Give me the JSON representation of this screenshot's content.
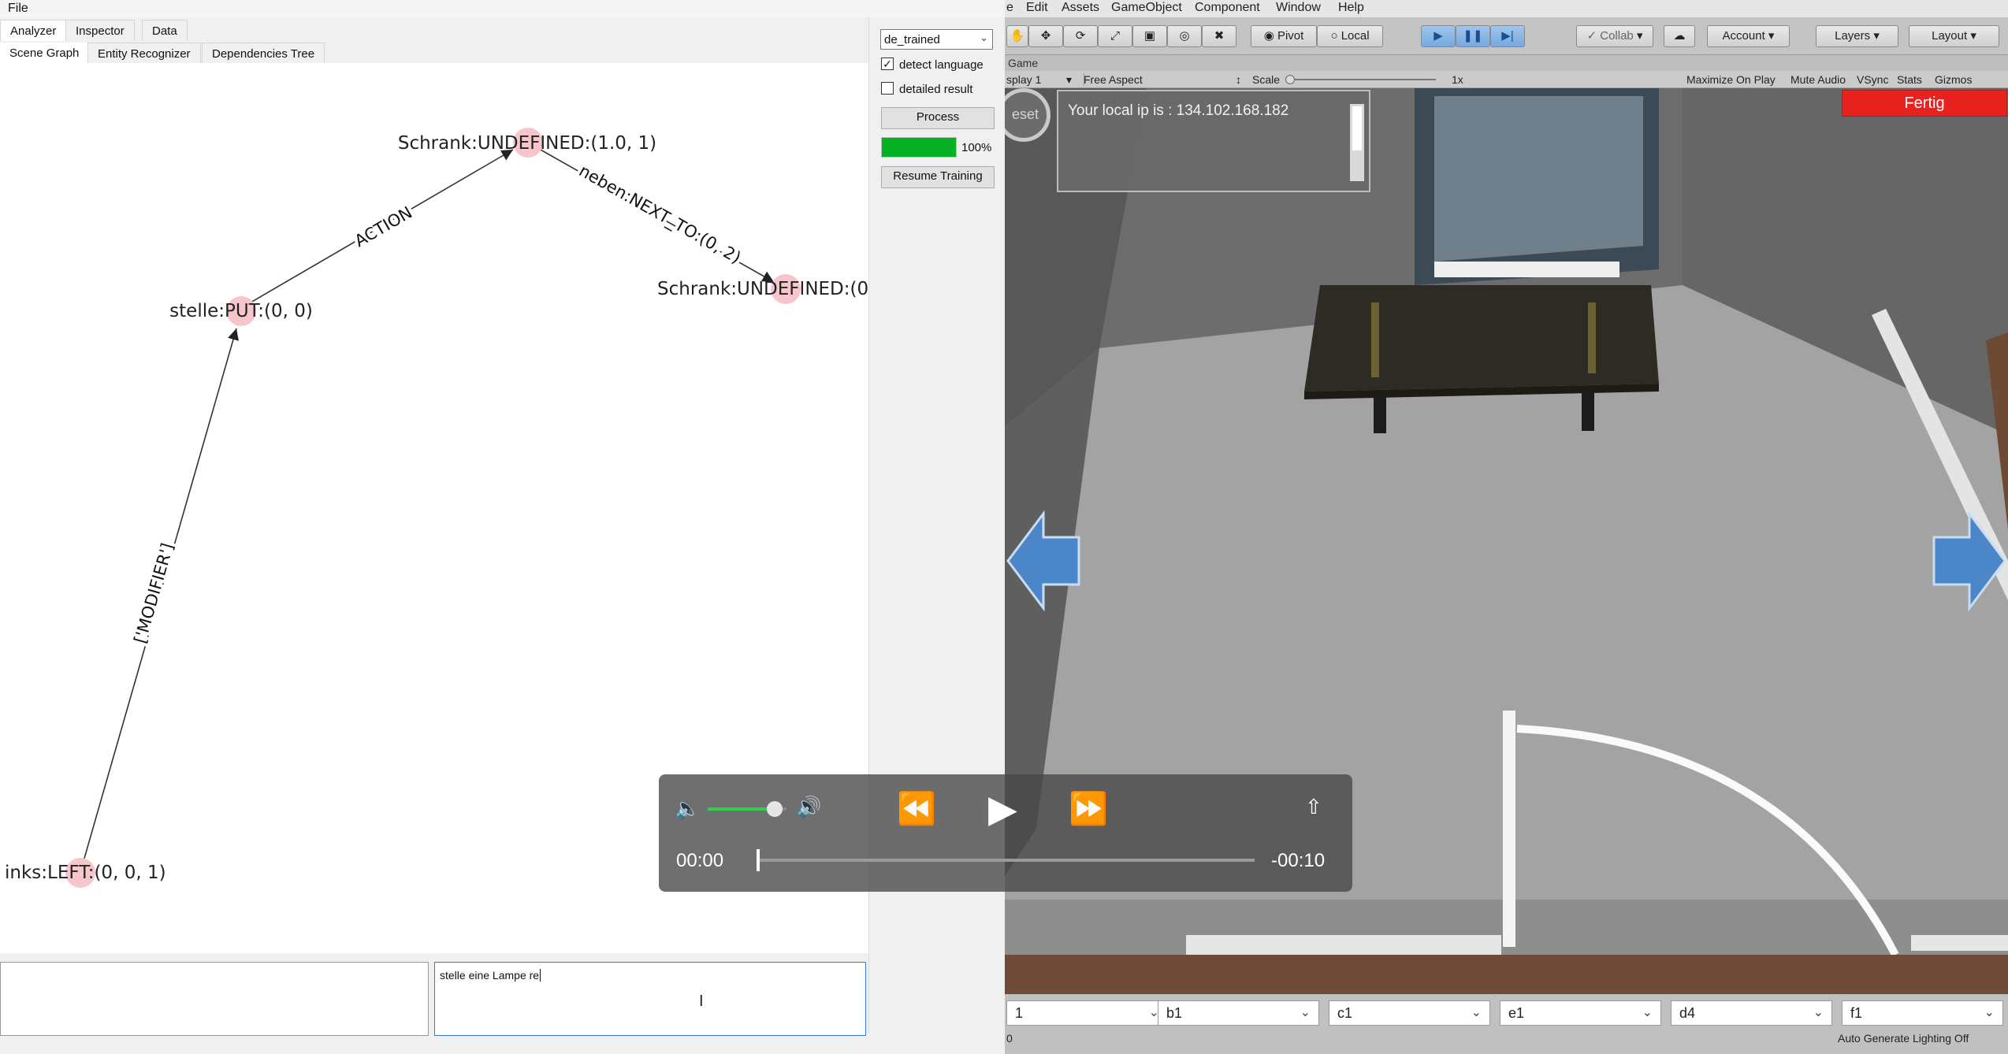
{
  "analyzer": {
    "menu": {
      "file": "File"
    },
    "top_tabs": [
      "Analyzer",
      "Inspector",
      "Data"
    ],
    "sub_tabs": [
      "Scene Graph",
      "Entity Recognizer",
      "Dependencies Tree"
    ],
    "graph": {
      "nodes": {
        "schrank1": "Schrank:UNDEFINED:(1.0, 1)",
        "stelle": "stelle:PUT:(0, 0)",
        "schrank2": "Schrank:UNDEFINED:(0",
        "links": "inks:LEFT:(0, 0, 1)"
      },
      "edges": {
        "action": "ACTION",
        "neben": "neben:NEXT_TO:(0, 2)",
        "modifier": "['MODIFIER']"
      }
    },
    "panel": {
      "model_select": "de_trained",
      "detect_language_label": "detect language",
      "detect_language_checked": true,
      "detailed_result_label": "detailed result",
      "detailed_result_checked": false,
      "process_label": "Process",
      "progress_value": 1.0,
      "progress_text": "100%",
      "resume_label": "Resume Training"
    },
    "input_text": "stelle eine Lampe re"
  },
  "unity": {
    "menu": [
      "e",
      "Edit",
      "Assets",
      "GameObject",
      "Component",
      "Window",
      "Help"
    ],
    "toolbar": {
      "pivot_label": "Pivot",
      "local_label": "Local",
      "collab_label": "Collab",
      "account_label": "Account",
      "layers_label": "Layers",
      "layout_label": "Layout"
    },
    "game_tab_label": "Game",
    "game_bar": {
      "display": "splay 1",
      "aspect": "Free Aspect",
      "scale_label": "Scale",
      "scale_value": "1x",
      "maximize": "Maximize On Play",
      "mute": "Mute Audio",
      "vsync": "VSync",
      "stats": "Stats",
      "gizmos": "Gizmos"
    },
    "scene": {
      "ip_text": "Your local ip is : 134.102.168.182",
      "reset_label": "eset",
      "fertig_label": "Fertig"
    },
    "dropdowns": [
      "1",
      "b1",
      "c1",
      "e1",
      "d4",
      "f1"
    ],
    "status_left": "0",
    "status_right": "Auto Generate Lighting Off",
    "colors": {
      "fertig": "#e8231f",
      "arrow": "#4a86c8"
    }
  },
  "video": {
    "current_time": "00:00",
    "remaining_time": "-00:10",
    "volume_level": 0.85
  }
}
